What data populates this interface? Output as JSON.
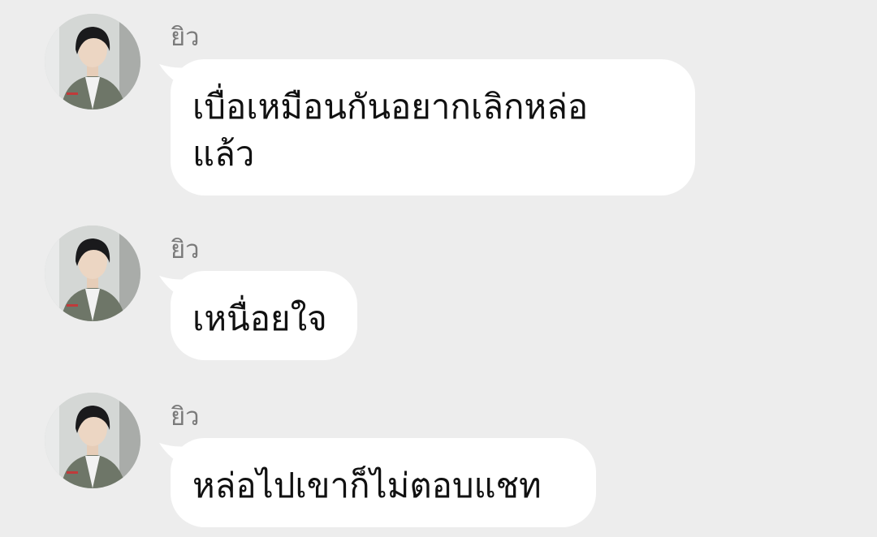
{
  "messages": [
    {
      "sender": "ยิว",
      "lines": [
        "เบื่อเหมือนกันอยากเลิกหล่อ",
        "แล้ว"
      ],
      "avatar_icon": "user-avatar"
    },
    {
      "sender": "ยิว",
      "lines": [
        "เหนื่อยใจ"
      ],
      "avatar_icon": "user-avatar"
    },
    {
      "sender": "ยิว",
      "lines": [
        "หล่อไปเขาก็ไม่ตอบแชท"
      ],
      "avatar_icon": "user-avatar"
    }
  ],
  "colors": {
    "background": "#ededed",
    "bubble": "#ffffff",
    "sender_name": "#7a7a7a",
    "text": "#111111"
  }
}
